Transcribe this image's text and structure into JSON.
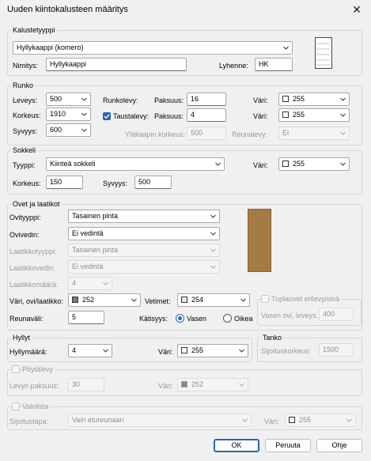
{
  "window": {
    "title": "Uuden kiintokalusteen määritys",
    "close_glyph": "✕"
  },
  "kalustetyyppi": {
    "legend": "Kalustetyyppi",
    "type_value": "Hyllykaappi (komero)",
    "nimitys_label": "Nimitys:",
    "nimitys_value": "Hyllykaappi",
    "lyhenne_label": "Lyhenne:",
    "lyhenne_value": "HK"
  },
  "runko": {
    "legend": "Runko",
    "leveys_label": "Leveys:",
    "leveys_value": "500",
    "korkeus_label": "Korkeus:",
    "korkeus_value": "1910",
    "syvyys_label": "Syvyys:",
    "syvyys_value": "600",
    "runkolevy_label": "Runkolevy:",
    "paksuus_label": "Paksuus:",
    "runkolevy_paksuus": "16",
    "taustalevy_label": "Taustalevy:",
    "taustalevy_checked": true,
    "taustalevy_paksuus": "4",
    "vari_label": "Väri:",
    "vari1_value": "255",
    "vari2_value": "255",
    "ylakaappi_label": "Yläkaapin korkeus:",
    "ylakaappi_value": "500",
    "reunalevy_label": "Reunalevy:",
    "reunalevy_value": "Ei"
  },
  "sokkeli": {
    "legend": "Sokkeli",
    "tyyppi_label": "Tyyppi:",
    "tyyppi_value": "Kiinteä sokkeli",
    "vari_label": "Väri:",
    "vari_value": "255",
    "korkeus_label": "Korkeus:",
    "korkeus_value": "150",
    "syvyys_label": "Syvyys:",
    "syvyys_value": "500"
  },
  "ovet": {
    "legend": "Ovet ja laatikot",
    "ovityyppi_label": "Ovityyppi:",
    "ovityyppi_value": "Tasainen pinta",
    "ovivedin_label": "Ovivedin:",
    "ovivedin_value": "Ei vedintä",
    "laatikkotyyppi_label": "Laatikkotyyppi:",
    "laatikkotyyppi_value": "Tasainen pinta",
    "laatikkovedin_label": "Laatikkovedin:",
    "laatikkovedin_value": "Ei vedintä",
    "laatikkomaara_label": "Laatikkomäärä:",
    "laatikkomaara_value": "4",
    "vari_label": "Väri, ovi/laatikko:",
    "vari_value": "252",
    "vetimet_label": "Vetimet:",
    "vetimet_value": "254",
    "reunavali_label": "Reunaväli:",
    "reunavali_value": "5",
    "katisyys_label": "Kätisyys:",
    "vasen_label": "Vasen",
    "oikea_label": "Oikea",
    "tuplaovet_label": "Tuplaovet erilevyisinä",
    "vasen_ovi_label": "Vasen ovi, leveys:",
    "vasen_ovi_value": "400",
    "door_color": "#a47a45"
  },
  "hyllyt": {
    "legend": "Hyllyt",
    "maara_label": "Hyllymäärä:",
    "maara_value": "4",
    "vari_label": "Väri:",
    "vari_value": "255"
  },
  "tanko": {
    "legend": "Tanko",
    "sijoitus_label": "Sijoituskorkeus:",
    "sijoitus_value": "1500"
  },
  "poytalevy": {
    "legend": "Pöytälevy",
    "paksuus_label": "Levyn paksuus:",
    "paksuus_value": "30",
    "vari_label": "Väri:",
    "vari_value": "252"
  },
  "valolista": {
    "legend": "Valolista",
    "sijoitustapa_label": "Sijoitustapa:",
    "sijoitustapa_value": "Vain etureunaan",
    "vari_label": "Väri:",
    "vari_value": "255"
  },
  "buttons": {
    "ok": "OK",
    "peruuta": "Peruuta",
    "ohje": "Ohje"
  }
}
